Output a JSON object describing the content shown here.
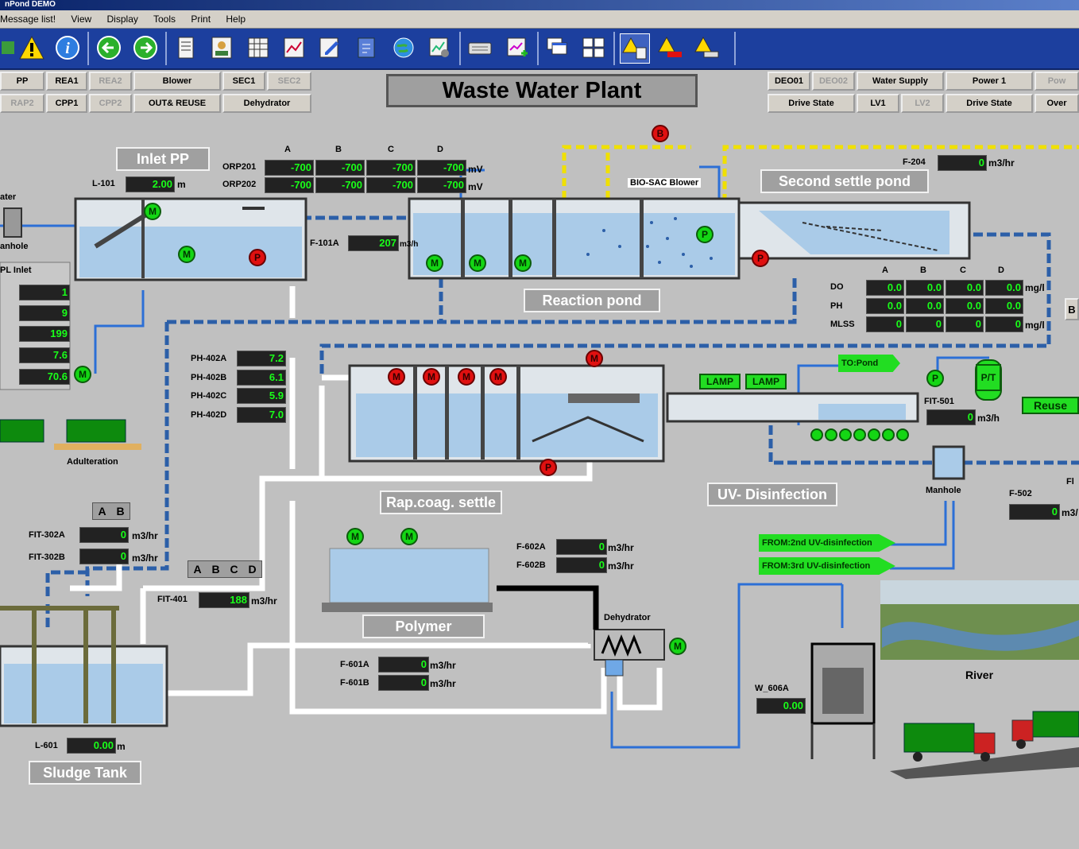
{
  "window": {
    "title": "nPond DEMO"
  },
  "menu": [
    "Message list!",
    "View",
    "Display",
    "Tools",
    "Print",
    "Help"
  ],
  "nav_left": [
    {
      "label": "PP",
      "dim": false
    },
    {
      "label": "REA1",
      "dim": false
    },
    {
      "label": "REA2",
      "dim": true
    },
    {
      "label": "Blower",
      "dim": false
    },
    {
      "label": "SEC1",
      "dim": false
    },
    {
      "label": "SEC2",
      "dim": true
    },
    {
      "label": "RAP2",
      "dim": true
    },
    {
      "label": "CPP1",
      "dim": false
    },
    {
      "label": "CPP2",
      "dim": true
    },
    {
      "label": "OUT& REUSE",
      "dim": false
    },
    {
      "label": "Dehydrator",
      "dim": false
    }
  ],
  "nav_right": [
    {
      "label": "DEO01",
      "dim": false
    },
    {
      "label": "DEO02",
      "dim": true
    },
    {
      "label": "Water Supply",
      "dim": false
    },
    {
      "label": "Power 1",
      "dim": false
    },
    {
      "label": "Pow",
      "dim": true
    },
    {
      "label": "Drive State",
      "dim": false
    },
    {
      "label": "LV1",
      "dim": false
    },
    {
      "label": "LV2",
      "dim": true
    },
    {
      "label": "Drive State",
      "dim": false
    },
    {
      "label": "Over",
      "dim": false
    }
  ],
  "main_title": "Waste Water Plant",
  "panels": {
    "inlet_pp": "Inlet PP",
    "second_settle": "Second settle pond",
    "reaction_pond": "Reaction pond",
    "rap_coag": "Rap.coag. settle",
    "uv": "UV- Disinfection",
    "polymer": "Polymer",
    "sludge_tank": "Sludge Tank"
  },
  "labels": {
    "ater": "ater",
    "anhole": "anhole",
    "pl_inlet": "PL Inlet",
    "adulteration": "Adulteration",
    "bio_sac": "BIO-SAC Blower",
    "dehydrator": "Dehydrator",
    "river": "River",
    "manhole": "Manhole",
    "lamp1": "LAMP",
    "lamp2": "LAMP",
    "to_pond": "TO:Pond",
    "reuse": "Reuse",
    "from2": "FROM:2nd UV-disinfection",
    "from3": "FROM:3rd UV-disinfection",
    "pt": "P/T",
    "fl": "Fl",
    "b": "B"
  },
  "inlet": {
    "l101_tag": "L-101",
    "l101": "2.00",
    "l101_unit": "m"
  },
  "orp": {
    "cols": [
      "A",
      "B",
      "C",
      "D"
    ],
    "rows": [
      {
        "tag": "ORP201",
        "values": [
          "-700",
          "-700",
          "-700",
          "-700"
        ],
        "unit": "mV"
      },
      {
        "tag": "ORP202",
        "values": [
          "-700",
          "-700",
          "-700",
          "-700"
        ],
        "unit": "mV"
      }
    ]
  },
  "f101a": {
    "tag": "F-101A",
    "value": "207",
    "unit": "m3/h"
  },
  "f204": {
    "tag": "F-204",
    "value": "0",
    "unit": "m3/hr"
  },
  "do_table": {
    "cols": [
      "A",
      "B",
      "C",
      "D"
    ],
    "rows": [
      {
        "tag": "DO",
        "values": [
          "0.0",
          "0.0",
          "0.0",
          "0.0"
        ],
        "unit": "mg/l"
      },
      {
        "tag": "PH",
        "values": [
          "0.0",
          "0.0",
          "0.0",
          "0.0"
        ],
        "unit": ""
      },
      {
        "tag": "MLSS",
        "values": [
          "0",
          "0",
          "0",
          "0"
        ],
        "unit": "mg/l"
      }
    ]
  },
  "inlet_values": [
    "1",
    "9",
    "199",
    "7.6",
    "70.6"
  ],
  "ph402": [
    {
      "tag": "PH-402A",
      "value": "7.2"
    },
    {
      "tag": "PH-402B",
      "value": "6.1"
    },
    {
      "tag": "PH-402C",
      "value": "5.9"
    },
    {
      "tag": "PH-402D",
      "value": "7.0"
    }
  ],
  "fit302": {
    "tab": [
      "A",
      "B"
    ],
    "rows": [
      {
        "tag": "FIT-302A",
        "value": "0",
        "unit": "m3/hr"
      },
      {
        "tag": "FIT-302B",
        "value": "0",
        "unit": "m3/hr"
      }
    ]
  },
  "fit401": {
    "tab": [
      "A",
      "B",
      "C",
      "D"
    ],
    "tag": "FIT-401",
    "value": "188",
    "unit": "m3/hr"
  },
  "f602": [
    {
      "tag": "F-602A",
      "value": "0",
      "unit": "m3/hr"
    },
    {
      "tag": "F-602B",
      "value": "0",
      "unit": "m3/hr"
    }
  ],
  "f601": [
    {
      "tag": "F-601A",
      "value": "0",
      "unit": "m3/hr"
    },
    {
      "tag": "F-601B",
      "value": "0",
      "unit": "m3/hr"
    }
  ],
  "fit501": {
    "tag": "FIT-501",
    "value": "0",
    "unit": "m3/h"
  },
  "f502": {
    "tag": "F-502",
    "value": "0",
    "unit": "m3/"
  },
  "w606a": {
    "tag": "W_606A",
    "value": "0.00"
  },
  "l601": {
    "tag": "L-601",
    "value": "0.00",
    "unit": "m"
  },
  "colors": {
    "accent": "#1c3f9e",
    "running": "#14d614",
    "stopped": "#e01010",
    "display_text": "#19ff19"
  }
}
